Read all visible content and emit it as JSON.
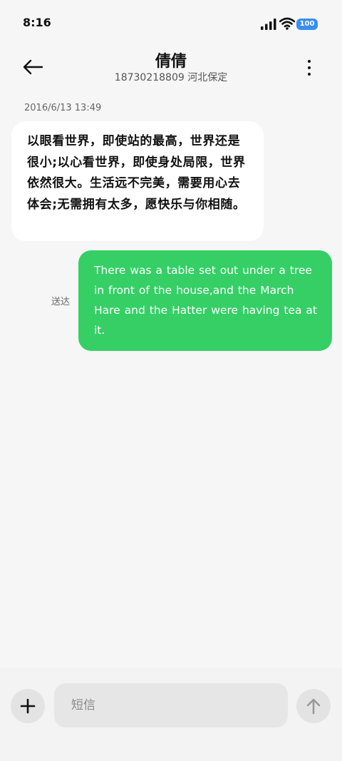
{
  "status_bar": {
    "time": "8:16",
    "battery": "100",
    "icons": [
      "signal-icon",
      "wifi-icon",
      "battery-icon"
    ],
    "battery_color": "#3a8ef0"
  },
  "header": {
    "contact_name": "倩倩",
    "contact_subtitle": "18730218809  河北保定",
    "icons": [
      "back-arrow-icon",
      "more-vertical-icon"
    ]
  },
  "conversation": {
    "timestamp": "2016/6/13 13:49",
    "messages": [
      {
        "direction": "incoming",
        "text": "以眼看世界，即使站的最高，世界还是很小;以心看世界，即使身处局限，世界依然很大。生活远不完美，需要用心去体会;无需拥有太多，愿快乐与你相随。",
        "bubble_color": "#ffffff"
      },
      {
        "direction": "outgoing",
        "text": "There was a table set out under a tree in front of the house,and the March Hare and the Hatter were having tea at it.",
        "status": "送达",
        "bubble_color": "#35cf66"
      }
    ]
  },
  "composer": {
    "placeholder": "短信",
    "value": "",
    "icons": [
      "plus-icon",
      "send-arrow-up-icon"
    ]
  }
}
